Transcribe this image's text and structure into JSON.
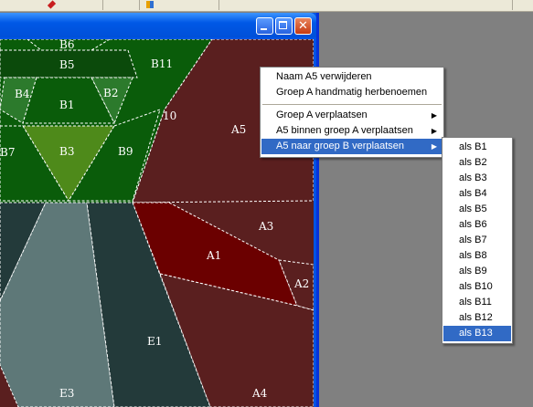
{
  "window": {
    "buttons": [
      "minimize",
      "maximize",
      "close"
    ]
  },
  "canvas": {
    "regions": [
      "B6",
      "B5",
      "B11",
      "B4",
      "B2",
      "B1",
      "10",
      "B7",
      "B3",
      "B9",
      "A5",
      "A3",
      "A1",
      "A2",
      "E1",
      "E3",
      "A4"
    ]
  },
  "context_menu": {
    "items": [
      {
        "label": "Naam A5 verwijderen",
        "submenu": false
      },
      {
        "label": "Groep A handmatig herbenoemen",
        "submenu": false
      },
      {
        "label": "Groep A verplaatsen",
        "submenu": true
      },
      {
        "label": "A5 binnen groep A verplaatsen",
        "submenu": true
      },
      {
        "label": "A5 naar groep B verplaatsen",
        "submenu": true,
        "selected": true
      }
    ],
    "arrow_glyph": "▶"
  },
  "submenu": {
    "items": [
      "als B1",
      "als B2",
      "als B3",
      "als B4",
      "als B5",
      "als B6",
      "als B7",
      "als B8",
      "als B9",
      "als B10",
      "als B11",
      "als B12",
      "als B13"
    ],
    "selected_index": 12
  },
  "colors": {
    "menu_highlight": "#316ac5",
    "region_dark_red": "#5a1f1f",
    "region_red": "#6b0000",
    "region_green": "#0a5c0a",
    "region_teal_dark": "#233a3a",
    "region_teal_light": "#5e7878"
  }
}
